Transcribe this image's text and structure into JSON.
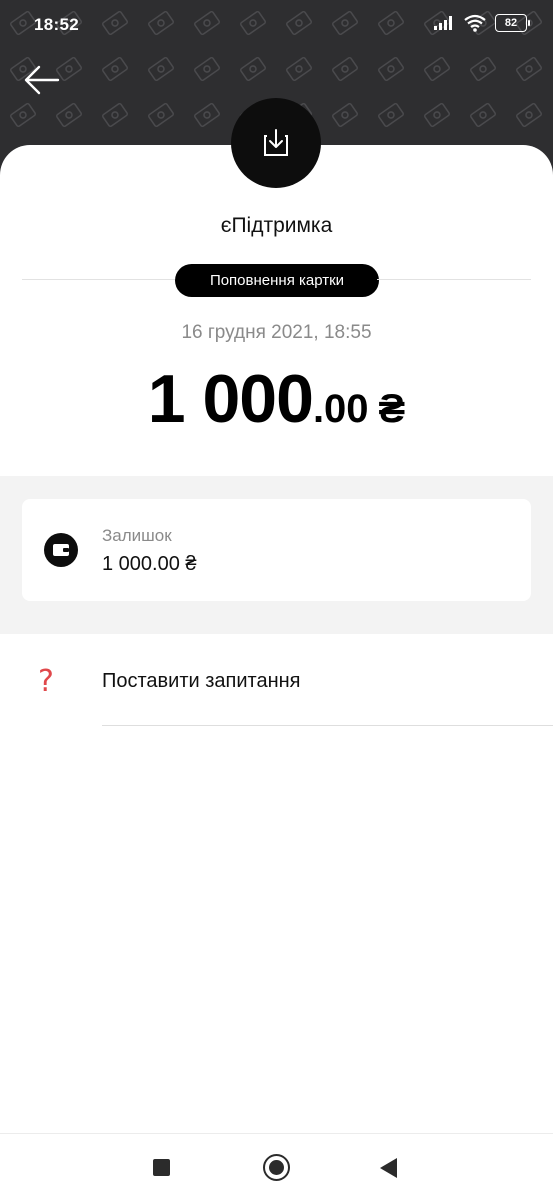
{
  "status_bar": {
    "time": "18:52",
    "battery": "82",
    "icons": [
      "signal-icon",
      "wifi-icon",
      "battery-icon"
    ]
  },
  "header": {
    "back_icon": "arrow-left-icon",
    "background_color": "#2e2e30"
  },
  "transaction": {
    "icon": "download-tray-icon",
    "merchant": "єПідтримка",
    "category": "Поповнення картки",
    "date": "16 грудня 2021, 18:55",
    "amount_integer": "1 000",
    "amount_decimal": ".00",
    "currency": "₴"
  },
  "balance": {
    "icon": "wallet-icon",
    "label": "Залишок",
    "value": "1 000.00 ₴"
  },
  "actions": {
    "ask_icon": "question-mark-icon",
    "ask_label": "Поставити запитання",
    "accent_color": "#e0484b"
  },
  "nav_bar": {
    "items": [
      "recents-square-icon",
      "home-circle-icon",
      "back-triangle-icon"
    ]
  }
}
